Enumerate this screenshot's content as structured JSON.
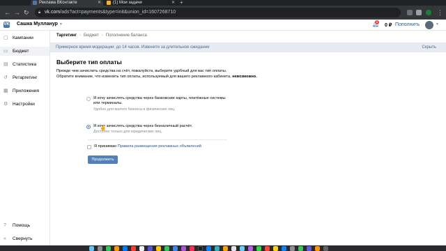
{
  "browser": {
    "tabs": [
      {
        "title": "Реклама ВКонтакте",
        "active": true,
        "color": "#4a76a8"
      },
      {
        "title": "(1) Мои задачи",
        "active": false,
        "color": "#ffb400"
      }
    ],
    "url_host": "vk.com",
    "url_path": "/ads?act=payments&type=init&union_id=1607268710"
  },
  "header": {
    "logo": "VK",
    "username": "Сашка Мулланур",
    "notification_count": "6",
    "balance": "0 ₽",
    "topup_label": "Пополнить"
  },
  "sidebar": {
    "items": [
      {
        "label": "Кампании",
        "icon": "campaigns-icon",
        "active": false
      },
      {
        "label": "Бюджет",
        "icon": "budget-icon",
        "active": true
      },
      {
        "label": "Статистика",
        "icon": "stats-icon",
        "active": false
      },
      {
        "label": "Ретаргетинг",
        "icon": "retargeting-icon",
        "active": false
      },
      {
        "label": "Приложения",
        "icon": "apps-icon",
        "active": false
      },
      {
        "label": "Настройки",
        "icon": "settings-icon",
        "active": false
      }
    ],
    "bottom_items": [
      {
        "label": "Помощь",
        "icon": "help-icon"
      },
      {
        "label": "Свернуть",
        "icon": "collapse-icon"
      }
    ]
  },
  "breadcrumb": [
    "Таргетинг",
    "Бюджет",
    "Пополнение баланса"
  ],
  "notice": {
    "text": "Примерное время модерации: до 14 часов. Извините за длительное ожидание",
    "hide_label": "Скрыть"
  },
  "main": {
    "title": "Выберите тип оплаты",
    "description": "Прежде чем зачислить средства на счёт, пожалуйста, выберите удобный для вас тип оплаты.",
    "description_2": "Обратите внимание, что изменить тип оплаты, используемый для вашего рекламного кабинета,",
    "description_bold": "невозможно.",
    "options": [
      {
        "label": "Я хочу зачислять средства через банковские карты, платёжные системы или терминалы.",
        "hint": "Удобно для малого бизнеса и физических лиц.",
        "checked": false
      },
      {
        "label": "Я хочу зачислять средства через безналичный расчёт.",
        "hint": "Доступно только для юридических лиц.",
        "checked": true
      }
    ],
    "agree_prefix": "Я принимаю",
    "agree_link": "Правила размещения рекламных объявлений",
    "submit_label": "Продолжить"
  }
}
